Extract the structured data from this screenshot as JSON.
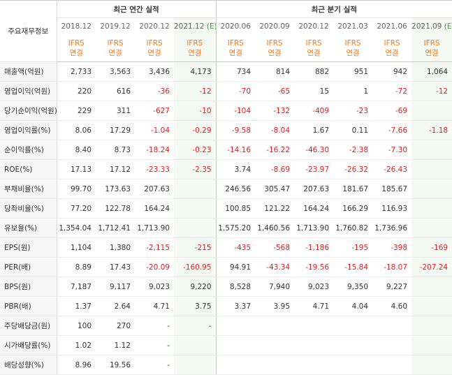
{
  "corner_label": "주요재무정보",
  "groups": {
    "annual": "최근 연간 실적",
    "quarter": "최근 분기 실적"
  },
  "periods": [
    {
      "label": "2018.12",
      "est": false
    },
    {
      "label": "2019.12",
      "est": false
    },
    {
      "label": "2020.12",
      "est": false
    },
    {
      "label": "2021.12",
      "est": true
    },
    {
      "label": "2020.06",
      "est": false
    },
    {
      "label": "2020.09",
      "est": false
    },
    {
      "label": "2020.12",
      "est": false
    },
    {
      "label": "2021.03",
      "est": false
    },
    {
      "label": "2021.06",
      "est": false
    },
    {
      "label": "2021.09",
      "est": true
    }
  ],
  "est_marker": "(E)",
  "ifrs_top": "IFRS",
  "ifrs_bottom": "연결",
  "colors": {
    "orange": "#f07c1e",
    "green": "#3aa836",
    "negative": "#e02020"
  },
  "rows": [
    {
      "label": "매출액(억원)",
      "values": [
        "2,733",
        "3,563",
        "3,436",
        "4,173",
        "734",
        "814",
        "882",
        "951",
        "942",
        "1,064"
      ]
    },
    {
      "label": "영업이익(억원)",
      "values": [
        "220",
        "616",
        "-36",
        "-12",
        "-70",
        "-65",
        "15",
        "1",
        "-72",
        "-12"
      ]
    },
    {
      "label": "당기순이익(억원)",
      "values": [
        "229",
        "311",
        "-627",
        "-10",
        "-104",
        "-132",
        "-409",
        "-23",
        "-69",
        ""
      ]
    },
    {
      "label": "영업이익률(%)",
      "values": [
        "8.06",
        "17.29",
        "-1.04",
        "-0.29",
        "-9.58",
        "-8.04",
        "1.67",
        "0.11",
        "-7.66",
        "-1.18"
      ]
    },
    {
      "label": "순이익률(%)",
      "values": [
        "8.40",
        "8.73",
        "-18.24",
        "-0.23",
        "-14.16",
        "-16.22",
        "-46.30",
        "-2.38",
        "-7.30",
        ""
      ]
    },
    {
      "label": "ROE(%)",
      "values": [
        "17.13",
        "17.12",
        "-23.33",
        "-2.35",
        "3.74",
        "-8.69",
        "-23.97",
        "-26.32",
        "-26.43",
        ""
      ]
    },
    {
      "label": "부채비율(%)",
      "values": [
        "99.70",
        "173.63",
        "207.63",
        "",
        "246.56",
        "305.47",
        "207.63",
        "181.67",
        "185.67",
        ""
      ]
    },
    {
      "label": "당좌비율(%)",
      "values": [
        "77.20",
        "122.78",
        "164.24",
        "",
        "100.85",
        "121.22",
        "164.24",
        "166.29",
        "116.93",
        ""
      ]
    },
    {
      "label": "유보율(%)",
      "values": [
        "1,354.04",
        "1,712.41",
        "1,713.90",
        "",
        "1,575.20",
        "1,460.56",
        "1,713.90",
        "1,760.82",
        "1,736.96",
        ""
      ]
    },
    {
      "label": "EPS(원)",
      "values": [
        "1,104",
        "1,380",
        "-2,115",
        "-215",
        "-435",
        "-568",
        "-1,186",
        "-195",
        "-398",
        "-169"
      ]
    },
    {
      "label": "PER(배)",
      "values": [
        "8.89",
        "17.43",
        "-20.09",
        "-160.95",
        "94.91",
        "-43.34",
        "-19.56",
        "-15.84",
        "-18.07",
        "-207.24"
      ]
    },
    {
      "label": "BPS(원)",
      "values": [
        "7,187",
        "9,117",
        "9,023",
        "9,220",
        "8,528",
        "7,940",
        "9,023",
        "9,350",
        "9,227",
        ""
      ]
    },
    {
      "label": "PBR(배)",
      "values": [
        "1.37",
        "2.64",
        "4.71",
        "3.75",
        "3.37",
        "3.95",
        "4.71",
        "4.04",
        "4.60",
        ""
      ]
    },
    {
      "label": "주당배당금(원)",
      "values": [
        "100",
        "270",
        "-",
        "-",
        "",
        "",
        "",
        "",
        "",
        ""
      ]
    },
    {
      "label": "시가배당률(%)",
      "values": [
        "1.02",
        "1.12",
        "-",
        "",
        "",
        "",
        "",
        "",
        "",
        ""
      ]
    },
    {
      "label": "배당성향(%)",
      "values": [
        "8.96",
        "19.56",
        "-",
        "",
        "",
        "",
        "",
        "",
        "",
        ""
      ]
    }
  ]
}
